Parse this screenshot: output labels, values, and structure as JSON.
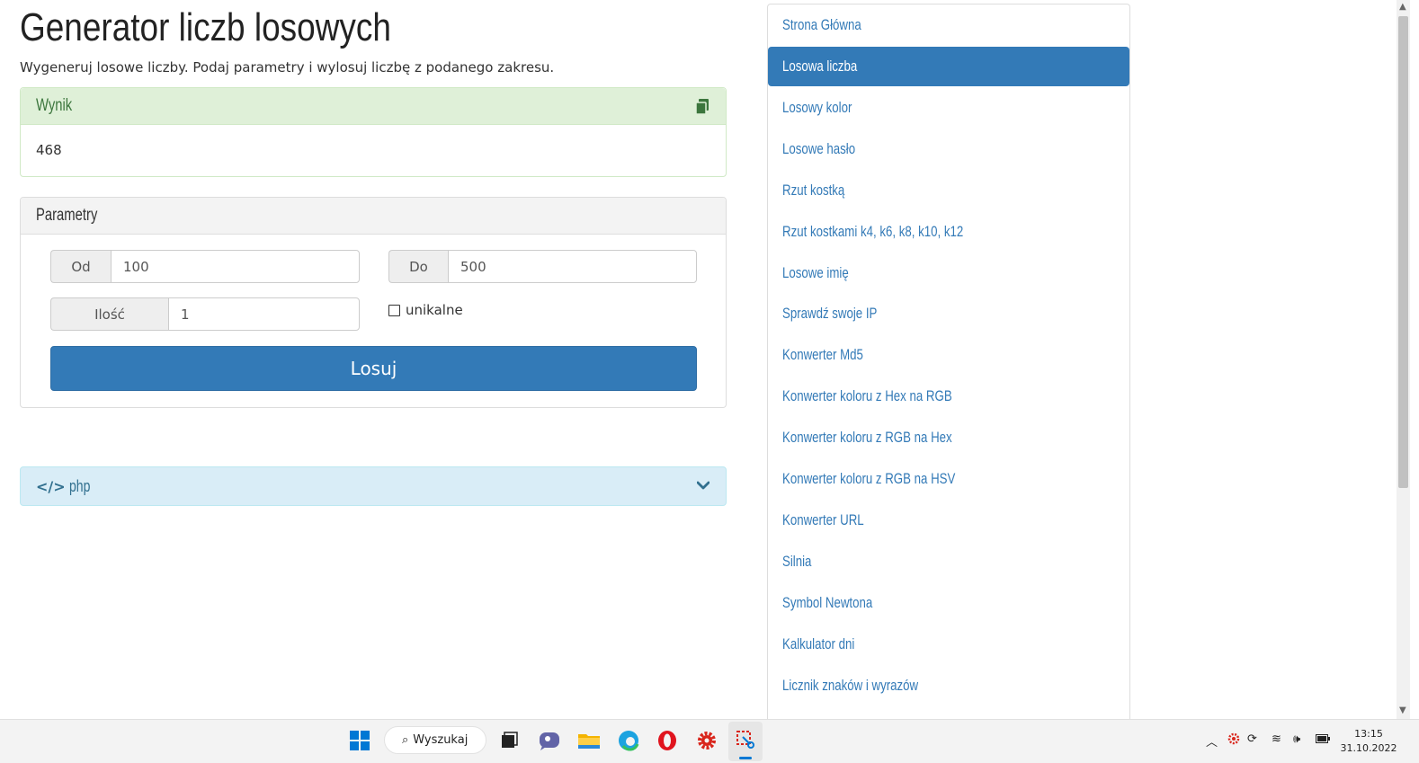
{
  "page": {
    "title": "Generator liczb losowych",
    "subtitle": "Wygeneruj losowe liczby. Podaj parametry i wylosuj liczbę z podanego zakresu."
  },
  "result": {
    "heading": "Wynik",
    "value": "468",
    "icons": {
      "copy": "copy-icon"
    }
  },
  "params": {
    "heading": "Parametry",
    "from_label": "Od",
    "from_value": "100",
    "to_label": "Do",
    "to_value": "500",
    "count_label": "Ilość",
    "count_value": "1",
    "unique_label": "unikalne",
    "unique_checked": false,
    "submit_label": "Losuj"
  },
  "code_panel": {
    "label": "php",
    "icons": [
      "code-icon",
      "chevron-down-icon"
    ]
  },
  "nav": {
    "items": [
      {
        "label": "Strona Główna",
        "active": false
      },
      {
        "label": "Losowa liczba",
        "active": true
      },
      {
        "label": "Losowy kolor",
        "active": false
      },
      {
        "label": "Losowe hasło",
        "active": false
      },
      {
        "label": "Rzut kostką",
        "active": false
      },
      {
        "label": "Rzut kostkami k4, k6, k8, k10, k12",
        "active": false
      },
      {
        "label": "Losowe imię",
        "active": false
      },
      {
        "label": "Sprawdź swoje IP",
        "active": false
      },
      {
        "label": "Konwerter Md5",
        "active": false
      },
      {
        "label": "Konwerter koloru z Hex na RGB",
        "active": false
      },
      {
        "label": "Konwerter koloru z RGB na Hex",
        "active": false
      },
      {
        "label": "Konwerter koloru z RGB na HSV",
        "active": false
      },
      {
        "label": "Konwerter URL",
        "active": false
      },
      {
        "label": "Silnia",
        "active": false
      },
      {
        "label": "Symbol Newtona",
        "active": false
      },
      {
        "label": "Kalkulator dni",
        "active": false
      },
      {
        "label": "Licznik znaków i wyrazów",
        "active": false
      }
    ]
  },
  "taskbar": {
    "search_label": "Wyszukaj",
    "time": "13:15",
    "date": "31.10.2022",
    "icons": [
      "windows-start-icon",
      "search-icon",
      "task-view-icon",
      "chat-icon",
      "file-explorer-icon",
      "edge-icon",
      "opera-icon",
      "settings-gear-icon",
      "snipping-tool-icon",
      "tray-chevron-up-icon",
      "tray-gear-icon",
      "tray-sync-icon",
      "wifi-icon",
      "volume-icon",
      "battery-icon"
    ]
  },
  "colors": {
    "primary": "#337ab7",
    "success_bg": "#dff0d8",
    "success_text": "#3c763d",
    "info_bg": "#d9edf7",
    "info_text": "#31708f"
  }
}
